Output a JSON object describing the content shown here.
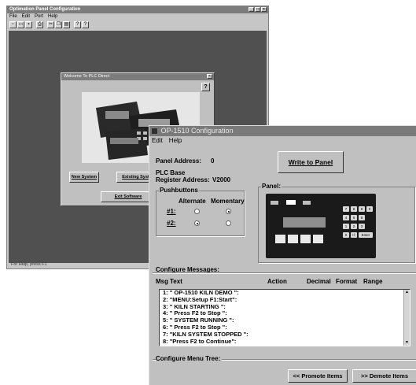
{
  "outer_window": {
    "title": "Optimation Panel Configuration",
    "menu": [
      "File",
      "Edit",
      "Port",
      "Help"
    ],
    "toolbar_icons": [
      "new-icon",
      "open-icon",
      "save-icon",
      "print-icon",
      "cut-icon",
      "copy-icon",
      "paste-icon",
      "about-icon",
      "help-icon"
    ],
    "status_text": "For Help, press F1"
  },
  "welcome_dialog": {
    "title": "Welcome To PLC Direct",
    "help_label": "?",
    "new_system_label": "New System",
    "existing_system_label": "Existing Syste",
    "exit_label": "Exit Software"
  },
  "config_dialog": {
    "title": "OP-1510 Configuration",
    "menu": [
      "Edit",
      "Help"
    ],
    "panel_address_label": "Panel Address:",
    "panel_address_value": "0",
    "plc_base_label": "PLC Base",
    "register_address_label": "Register Address:",
    "register_address_value": "V2000",
    "write_button_label": "Write to Panel",
    "pushbuttons": {
      "title": "Pushbuttons",
      "col_alternate": "Alternate",
      "col_momentary": "Momentary",
      "rows": [
        {
          "label": "#1:",
          "alternate": false,
          "momentary": true
        },
        {
          "label": "#2:",
          "alternate": true,
          "momentary": false
        }
      ]
    },
    "panel_group_title": "Panel:",
    "panel_keys": [
      "7",
      "8",
      "9",
      "0",
      "4",
      "5",
      "6",
      "1",
      "2",
      "3",
      "0",
      "+/-",
      "Enter"
    ],
    "configure_messages_label": "Configure Messages:",
    "columns": {
      "msg": "Msg",
      "text": "Text",
      "action": "Action",
      "decimal": "Decimal",
      "format": "Format",
      "range": "Range"
    },
    "messages": [
      "1: \" OP-1510 KILN DEMO  \":",
      "2: \"MENU:Setup  F1:Start\":",
      "3: \"   KILN STARTING     \":",
      "4: \" Press F2 to Stop  \":",
      "5: \"  SYSTEM RUNNING    \":",
      "6: \" Press F2 to Stop  \":",
      "7: \"KILN SYSTEM STOPPED \":",
      "8: \"Press F2 to Continue\":"
    ],
    "configure_menu_tree_label": "Configure Menu Tree:",
    "promote_label": "<< Promote Items",
    "demote_label": ">> Demote Items"
  },
  "colors": {
    "workspace": "#505050",
    "dialog": "#c0c0c0",
    "titlebar": "#7a7a7a"
  }
}
